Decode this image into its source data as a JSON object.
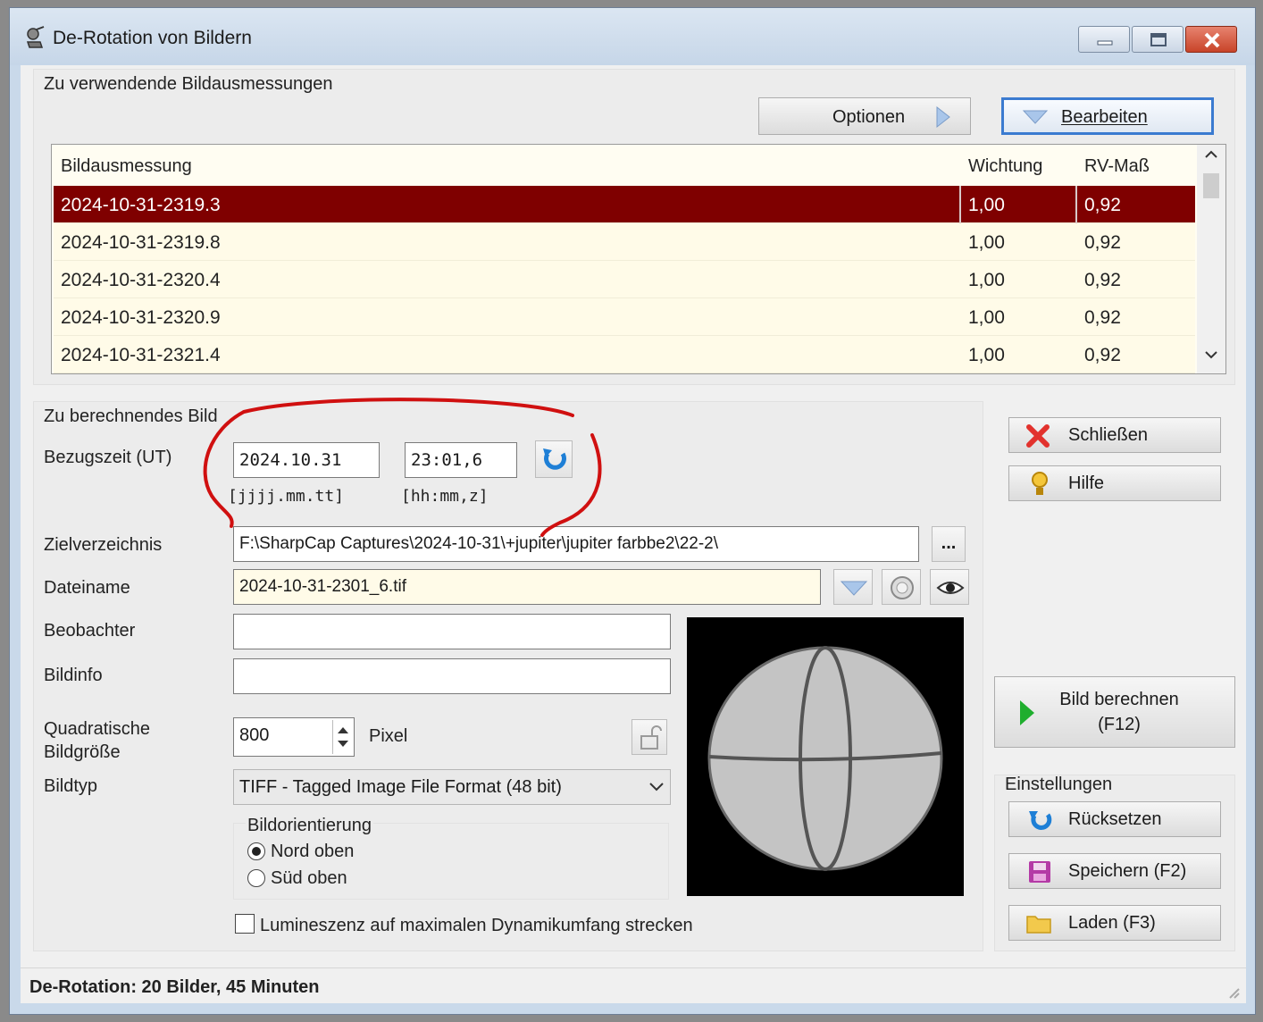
{
  "window": {
    "title": "De-Rotation von Bildern"
  },
  "measurements": {
    "group_label": "Zu verwendende Bildausmessungen",
    "options_button": "Optionen",
    "edit_button": "Bearbeiten",
    "columns": [
      "Bildausmessung",
      "Wichtung",
      "RV-Maß"
    ],
    "rows": [
      {
        "name": "2024-10-31-2319.3",
        "weight": "1,00",
        "rv": "0,92"
      },
      {
        "name": "2024-10-31-2319.8",
        "weight": "1,00",
        "rv": "0,92"
      },
      {
        "name": "2024-10-31-2320.4",
        "weight": "1,00",
        "rv": "0,92"
      },
      {
        "name": "2024-10-31-2320.9",
        "weight": "1,00",
        "rv": "0,92"
      },
      {
        "name": "2024-10-31-2321.4",
        "weight": "1,00",
        "rv": "0,92"
      }
    ]
  },
  "image": {
    "group_label": "Zu berechnendes Bild",
    "reftime_label": "Bezugszeit (UT)",
    "date_value": "2024.10.31",
    "time_value": "23:01,6",
    "date_hint": "[jjjj.mm.tt]",
    "time_hint": "[hh:mm,z]",
    "targetdir_label": "Zielverzeichnis",
    "targetdir_value": "F:\\SharpCap Captures\\2024-10-31\\+jupiter\\jupiter farbbe2\\22-2\\",
    "browse_label": "...",
    "filename_label": "Dateiname",
    "filename_value": "2024-10-31-2301_6.tif",
    "observer_label": "Beobachter",
    "observer_value": "",
    "info_label": "Bildinfo",
    "info_value": "",
    "size_label_1": "Quadratische",
    "size_label_2": "Bildgröße",
    "size_value": "800",
    "size_unit": "Pixel",
    "type_label": "Bildtyp",
    "type_value": "TIFF - Tagged Image File Format (48 bit)",
    "orientation_label": "Bildorientierung",
    "orientation_north": "Nord oben",
    "orientation_south": "Süd oben",
    "orientation_selected": "Nord oben",
    "luminance_label": "Lumineszenz auf maximalen Dynamikumfang strecken",
    "luminance_checked": false
  },
  "actions": {
    "close": "Schließen",
    "help": "Hilfe",
    "compute_line1": "Bild berechnen",
    "compute_line2": "(F12)",
    "settings_label": "Einstellungen",
    "reset": "Rücksetzen",
    "save": "Speichern (F2)",
    "load": "Laden (F3)"
  },
  "status": {
    "text": "De-Rotation: 20 Bilder, 45 Minuten"
  },
  "colors": {
    "selection": "#7f0000",
    "annotation": "#d01010",
    "list_background": "#fffbe8"
  },
  "icons": [
    "app-icon",
    "minimize-icon",
    "maximize-icon",
    "close-icon",
    "play-arrow-icon",
    "dropdown-triangle-icon",
    "refresh-icon",
    "x-close-icon",
    "help-bulb-icon",
    "play-icon",
    "reset-icon",
    "save-disk-icon",
    "folder-icon",
    "eye-icon",
    "lock-icon"
  ]
}
